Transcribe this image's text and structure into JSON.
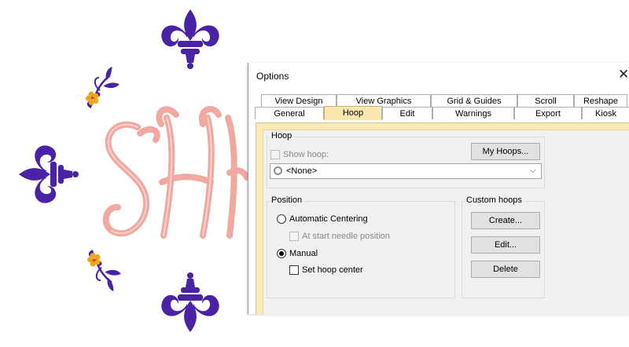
{
  "window": {
    "title": "Options"
  },
  "tabs_back": [
    "View Design",
    "View Graphics",
    "Grid & Guides",
    "Scroll",
    "Reshape"
  ],
  "tabs_front": [
    "General",
    "Hoop",
    "Edit",
    "Warnings",
    "Export",
    "Kiosk"
  ],
  "active_tab": "Hoop",
  "hoop_group": {
    "label": "Hoop",
    "show_hoop_label": "Show hoop:",
    "show_hoop_checked": false,
    "my_hoops_button": "My Hoops...",
    "hoop_select_value": "<None>"
  },
  "position_group": {
    "label": "Position",
    "automatic_centering_label": "Automatic Centering",
    "at_start_needle_label": "At start needle position",
    "manual_label": "Manual",
    "set_hoop_center_label": "Set hoop center",
    "selected": "Manual"
  },
  "custom_hoops_group": {
    "label": "Custom hoops",
    "create_button": "Create...",
    "edit_button": "Edit...",
    "delete_button": "Delete"
  },
  "colors": {
    "embroidery_purple": "#4a22a6",
    "embroidery_pink": "#f0a8a0",
    "embroidery_gold": "#f2a51a",
    "tab_active": "#fbe7b0"
  },
  "icons": [
    "fleur-de-lis-icon",
    "flower-sprig-icon",
    "close-icon",
    "chevron-down-icon",
    "hoop-icon"
  ]
}
